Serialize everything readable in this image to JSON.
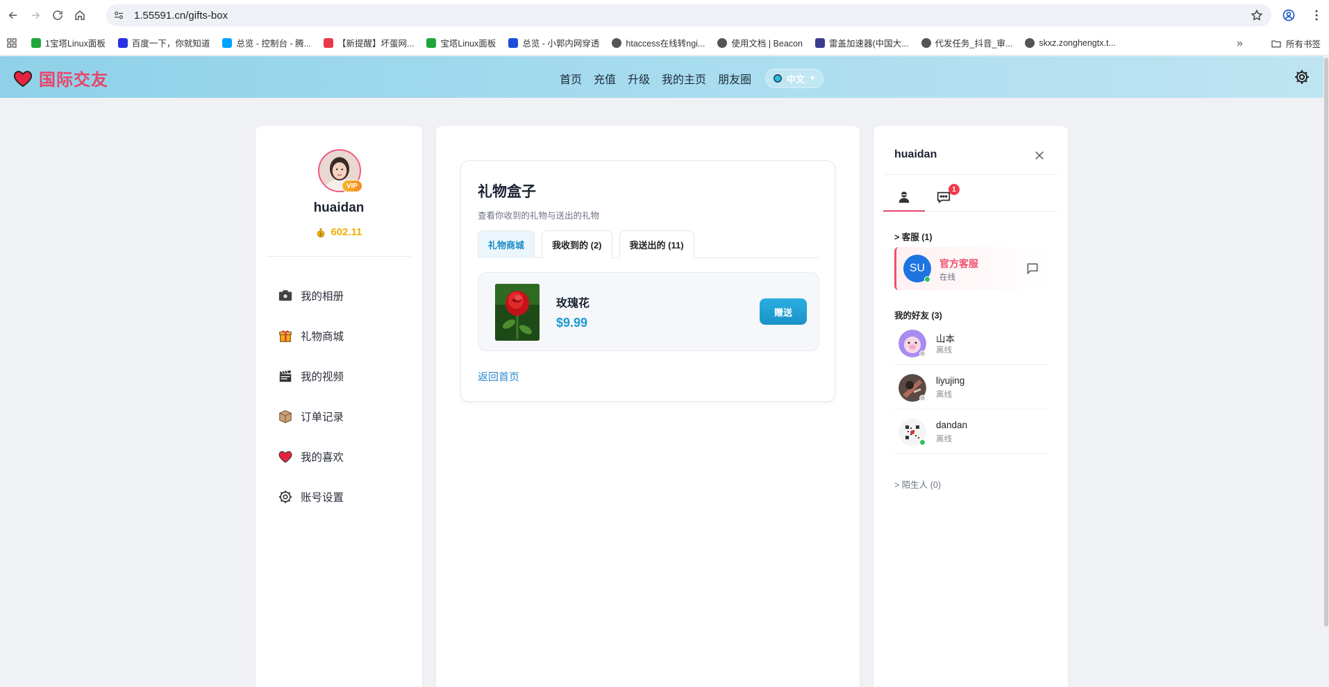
{
  "browser": {
    "url": "1.55591.cn/gifts-box",
    "bookmarks": [
      {
        "label": "1宝塔Linux面板",
        "color": "#20a53a"
      },
      {
        "label": "百度一下，你就知道",
        "color": "#2932e1"
      },
      {
        "label": "总览 - 控制台 - 腾...",
        "color": "#00a4ff"
      },
      {
        "label": "【新提醒】坏蛋网...",
        "color": "#e83a4a"
      },
      {
        "label": "宝塔Linux面板",
        "color": "#20a53a"
      },
      {
        "label": "总览 - 小郭内网穿透",
        "color": "#1d4ed8"
      },
      {
        "label": "htaccess在线转ngi...",
        "color": "#555555"
      },
      {
        "label": "使用文档 | Beacon",
        "color": "#555555"
      },
      {
        "label": "雷盖加速器(中国大...",
        "color": "#3b3b8f"
      },
      {
        "label": "代发任务_抖音_审...",
        "color": "#555555"
      },
      {
        "label": "skxz.zonghengtx.t...",
        "color": "#555555"
      }
    ],
    "all_bookmarks_label": "所有书签",
    "more_label": "»"
  },
  "header": {
    "logo_text": "国际交友",
    "nav": [
      "首页",
      "充值",
      "升级",
      "我的主页",
      "朋友圈"
    ],
    "language": "中文",
    "accent_color": "#e8436b"
  },
  "profile": {
    "vip_label": "VIP",
    "username": "huaidan",
    "balance": "602.11"
  },
  "side_menu": [
    {
      "label": "我的相册",
      "icon": "camera-icon"
    },
    {
      "label": "礼物商城",
      "icon": "gift-icon"
    },
    {
      "label": "我的视频",
      "icon": "clapperboard-icon"
    },
    {
      "label": "订单记录",
      "icon": "package-icon"
    },
    {
      "label": "我的喜欢",
      "icon": "heart-icon"
    },
    {
      "label": "账号设置",
      "icon": "gear-icon"
    }
  ],
  "gift_box": {
    "title": "礼物盒子",
    "subtitle": "查看你收到的礼物与送出的礼物",
    "tabs": [
      "礼物商城",
      "我收到的 (2)",
      "我送出的 (11)"
    ],
    "active_tab": 0,
    "items": [
      {
        "name": "玫瑰花",
        "price": "$9.99",
        "action": "赠送"
      }
    ],
    "back_link": "返回首页"
  },
  "chat_panel": {
    "username": "huaidan",
    "unread_badge": "1",
    "support_section": "> 客服 (1)",
    "support": {
      "avatar_text": "SU",
      "name": "官方客服",
      "status": "在线"
    },
    "friends_section": "我的好友 (3)",
    "friends": [
      {
        "name": "山本",
        "status": "离线"
      },
      {
        "name": "liyujing",
        "status": "离线"
      },
      {
        "name": "dandan",
        "status": "离线"
      }
    ],
    "strangers_section": "> 陌生人 (0)"
  }
}
